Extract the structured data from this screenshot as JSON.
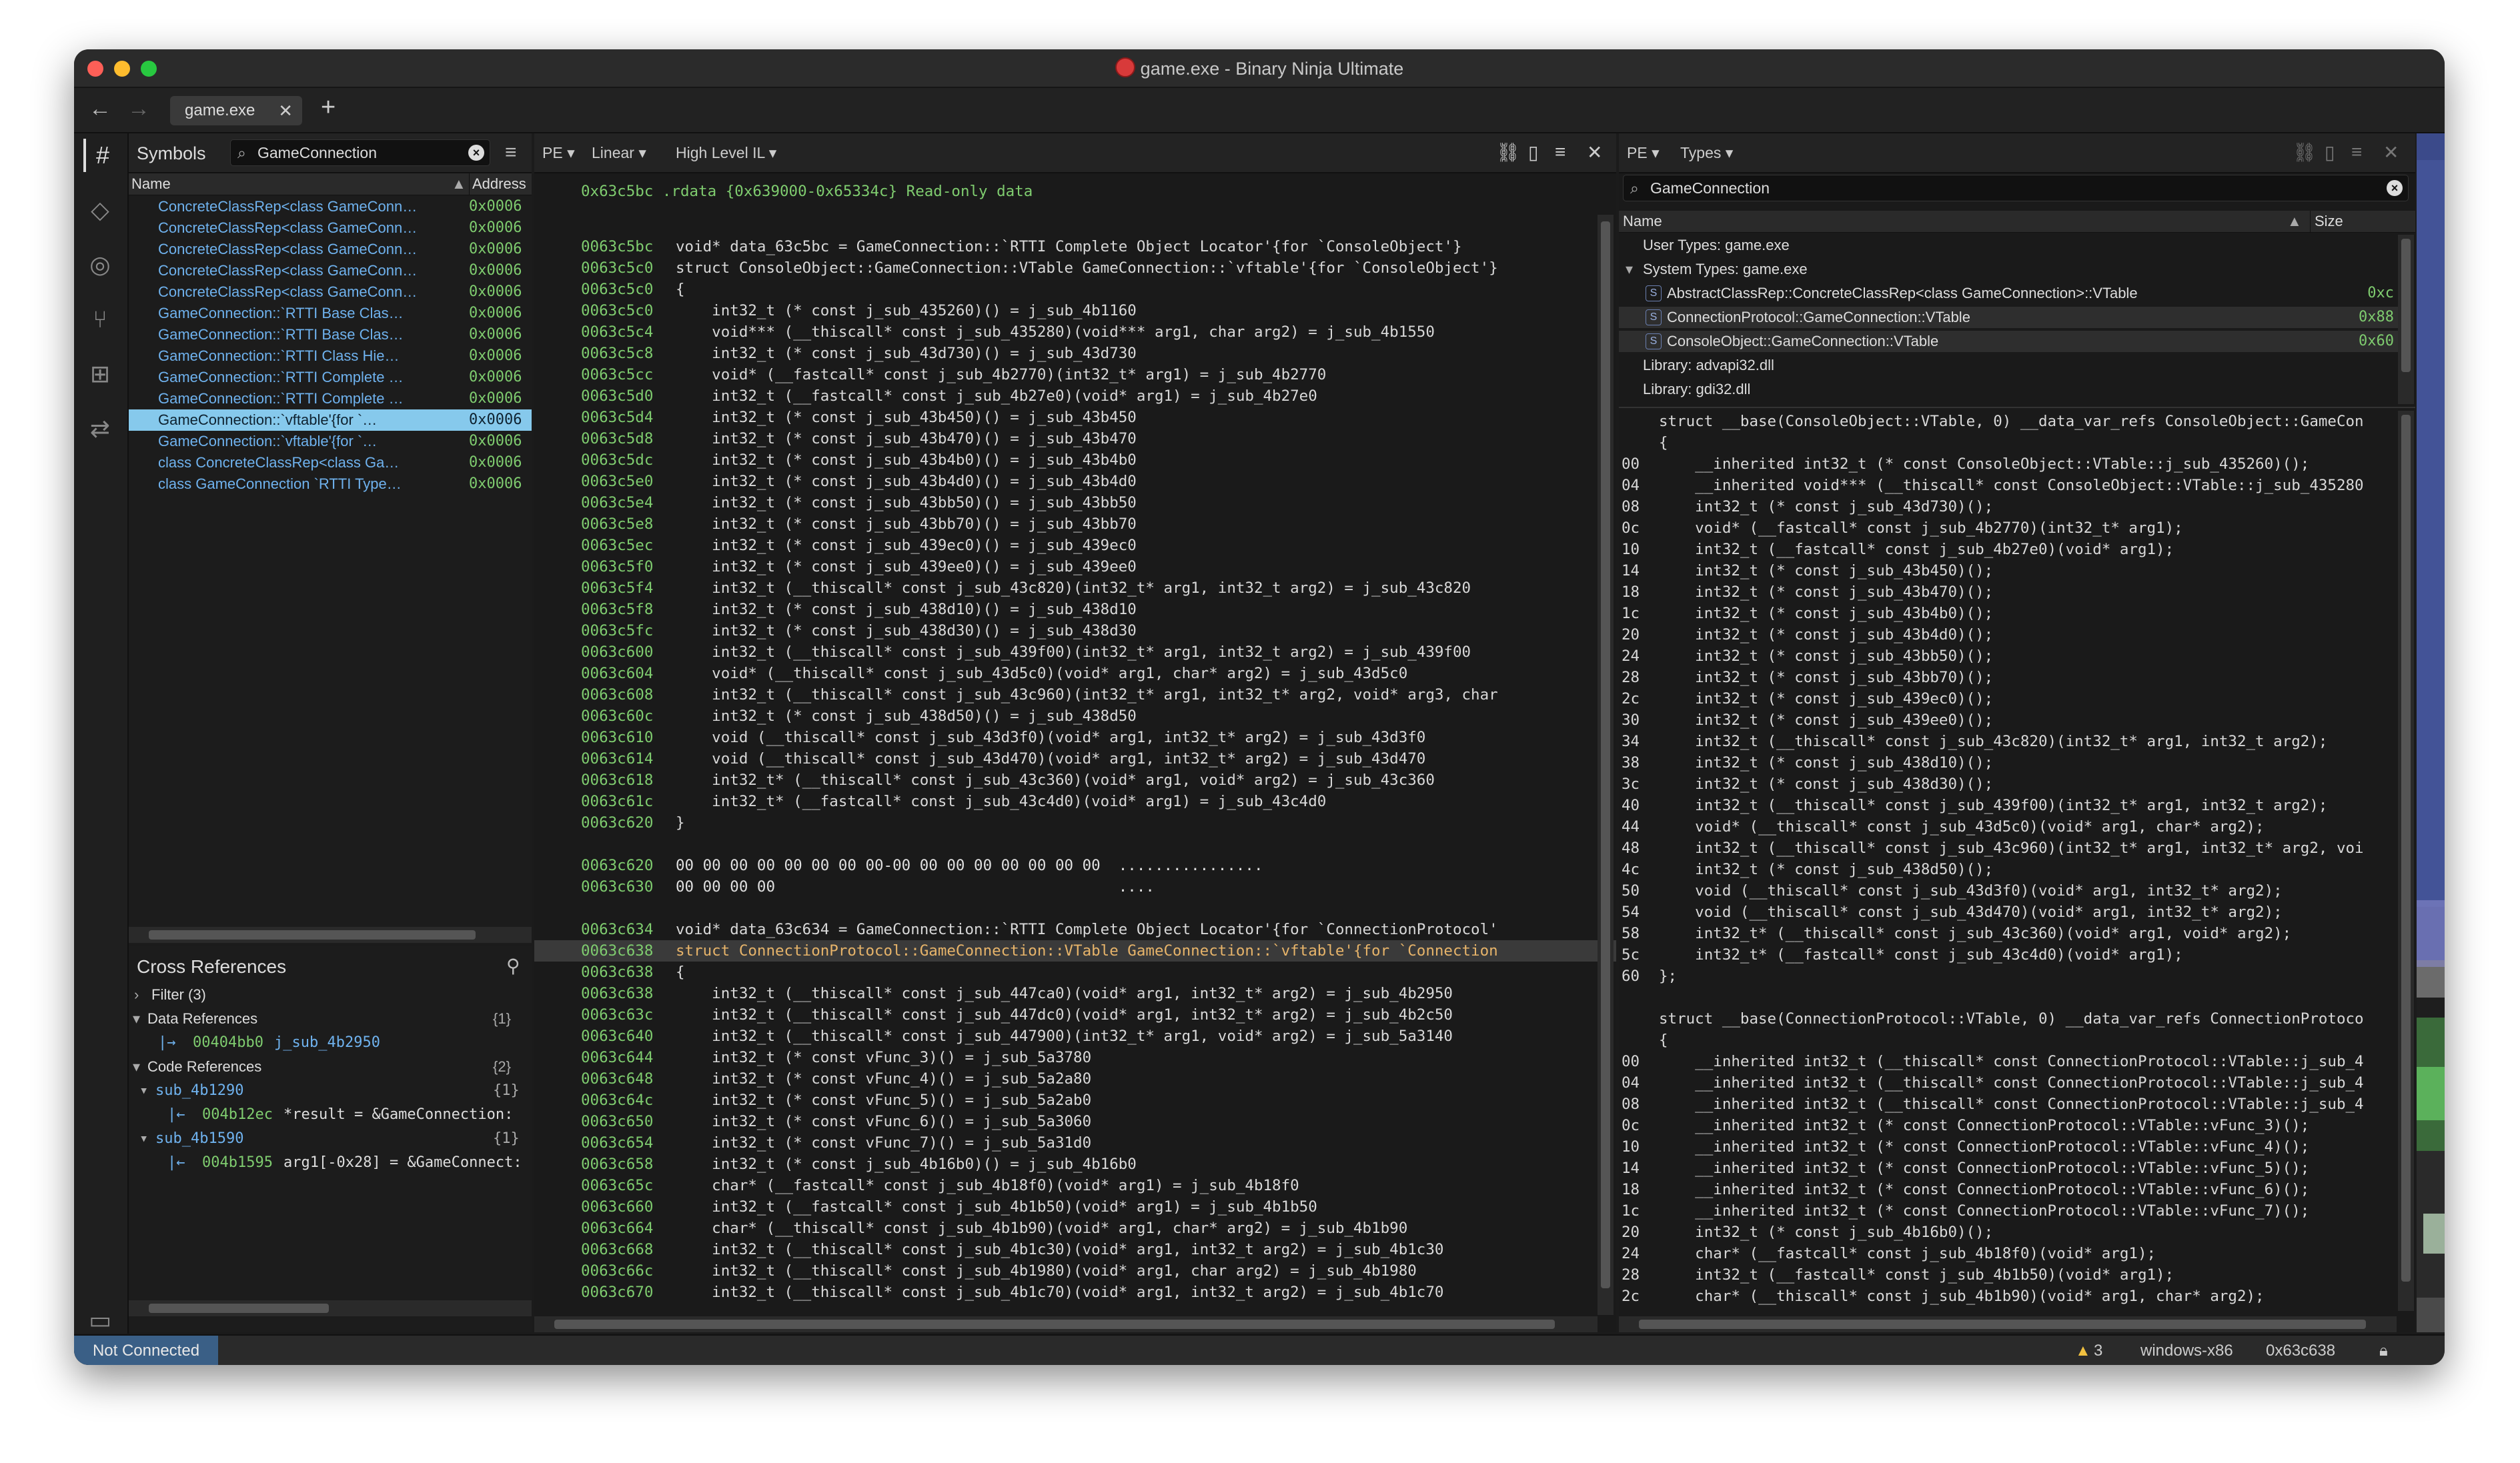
{
  "window": {
    "title": "game.exe - Binary Ninja Ultimate"
  },
  "tabs": [
    {
      "label": "game.exe"
    }
  ],
  "symbols": {
    "title": "Symbols",
    "search_value": "GameConnection",
    "col_name": "Name",
    "col_address": "Address",
    "rows": [
      {
        "name": "ConcreteClassRep<class GameConn…",
        "addr": "0x0006"
      },
      {
        "name": "ConcreteClassRep<class GameConn…",
        "addr": "0x0006"
      },
      {
        "name": "ConcreteClassRep<class GameConn…",
        "addr": "0x0006"
      },
      {
        "name": "ConcreteClassRep<class GameConn…",
        "addr": "0x0006"
      },
      {
        "name": "ConcreteClassRep<class GameConn…",
        "addr": "0x0006"
      },
      {
        "name": "GameConnection::`RTTI Base Clas…",
        "addr": "0x0006"
      },
      {
        "name": "GameConnection::`RTTI Base Clas…",
        "addr": "0x0006"
      },
      {
        "name": "GameConnection::`RTTI Class Hie…",
        "addr": "0x0006"
      },
      {
        "name": "GameConnection::`RTTI Complete …",
        "addr": "0x0006"
      },
      {
        "name": "GameConnection::`RTTI Complete …",
        "addr": "0x0006"
      },
      {
        "name": "GameConnection::`vftable'{for `…",
        "addr": "0x0006"
      },
      {
        "name": "GameConnection::`vftable'{for `…",
        "addr": "0x0006"
      },
      {
        "name": "class ConcreteClassRep<class Ga…",
        "addr": "0x0006"
      },
      {
        "name": "class GameConnection `RTTI Type…",
        "addr": "0x0006"
      }
    ]
  },
  "xrefs": {
    "title": "Cross References",
    "filter": "Filter (3)",
    "data_refs": {
      "label": "Data References",
      "count": "{1}",
      "items": [
        {
          "addr": "00404bb0",
          "text": "j_sub_4b2950"
        }
      ]
    },
    "code_refs": {
      "label": "Code References",
      "count": "{2}",
      "groups": [
        {
          "name": "sub_4b1290",
          "count": "{1}",
          "addr": "004b12ec",
          "text": "*result = &GameConnection:"
        },
        {
          "name": "sub_4b1590",
          "count": "{1}",
          "addr": "004b1595",
          "text": "arg1[-0x28] = &GameConnect:"
        }
      ]
    }
  },
  "center": {
    "view_type": "PE",
    "layout": "Linear",
    "il": "High Level IL",
    "header": "0x63c5bc .rdata {0x639000-0x65334c} Read-only data",
    "lines": [
      {
        "a": "",
        "t": ""
      },
      {
        "a": "0063c5bc",
        "t": "void* data_63c5bc = GameConnection::`RTTI Complete Object Locator'{for `ConsoleObject'}"
      },
      {
        "a": "0063c5c0",
        "t": "struct ConsoleObject::GameConnection::VTable GameConnection::`vftable'{for `ConsoleObject'}"
      },
      {
        "a": "0063c5c0",
        "t": "{"
      },
      {
        "a": "0063c5c0",
        "t": "    int32_t (* const j_sub_435260)() = j_sub_4b1160"
      },
      {
        "a": "0063c5c4",
        "t": "    void*** (__thiscall* const j_sub_435280)(void*** arg1, char arg2) = j_sub_4b1550"
      },
      {
        "a": "0063c5c8",
        "t": "    int32_t (* const j_sub_43d730)() = j_sub_43d730"
      },
      {
        "a": "0063c5cc",
        "t": "    void* (__fastcall* const j_sub_4b2770)(int32_t* arg1) = j_sub_4b2770"
      },
      {
        "a": "0063c5d0",
        "t": "    int32_t (__fastcall* const j_sub_4b27e0)(void* arg1) = j_sub_4b27e0"
      },
      {
        "a": "0063c5d4",
        "t": "    int32_t (* const j_sub_43b450)() = j_sub_43b450"
      },
      {
        "a": "0063c5d8",
        "t": "    int32_t (* const j_sub_43b470)() = j_sub_43b470"
      },
      {
        "a": "0063c5dc",
        "t": "    int32_t (* const j_sub_43b4b0)() = j_sub_43b4b0"
      },
      {
        "a": "0063c5e0",
        "t": "    int32_t (* const j_sub_43b4d0)() = j_sub_43b4d0"
      },
      {
        "a": "0063c5e4",
        "t": "    int32_t (* const j_sub_43bb50)() = j_sub_43bb50"
      },
      {
        "a": "0063c5e8",
        "t": "    int32_t (* const j_sub_43bb70)() = j_sub_43bb70"
      },
      {
        "a": "0063c5ec",
        "t": "    int32_t (* const j_sub_439ec0)() = j_sub_439ec0"
      },
      {
        "a": "0063c5f0",
        "t": "    int32_t (* const j_sub_439ee0)() = j_sub_439ee0"
      },
      {
        "a": "0063c5f4",
        "t": "    int32_t (__thiscall* const j_sub_43c820)(int32_t* arg1, int32_t arg2) = j_sub_43c820"
      },
      {
        "a": "0063c5f8",
        "t": "    int32_t (* const j_sub_438d10)() = j_sub_438d10"
      },
      {
        "a": "0063c5fc",
        "t": "    int32_t (* const j_sub_438d30)() = j_sub_438d30"
      },
      {
        "a": "0063c600",
        "t": "    int32_t (__thiscall* const j_sub_439f00)(int32_t* arg1, int32_t arg2) = j_sub_439f00"
      },
      {
        "a": "0063c604",
        "t": "    void* (__thiscall* const j_sub_43d5c0)(void* arg1, char* arg2) = j_sub_43d5c0"
      },
      {
        "a": "0063c608",
        "t": "    int32_t (__thiscall* const j_sub_43c960)(int32_t* arg1, int32_t* arg2, void* arg3, char"
      },
      {
        "a": "0063c60c",
        "t": "    int32_t (* const j_sub_438d50)() = j_sub_438d50"
      },
      {
        "a": "0063c610",
        "t": "    void (__thiscall* const j_sub_43d3f0)(void* arg1, int32_t* arg2) = j_sub_43d3f0"
      },
      {
        "a": "0063c614",
        "t": "    void (__thiscall* const j_sub_43d470)(void* arg1, int32_t* arg2) = j_sub_43d470"
      },
      {
        "a": "0063c618",
        "t": "    int32_t* (__thiscall* const j_sub_43c360)(void* arg1, void* arg2) = j_sub_43c360"
      },
      {
        "a": "0063c61c",
        "t": "    int32_t* (__fastcall* const j_sub_43c4d0)(void* arg1) = j_sub_43c4d0"
      },
      {
        "a": "0063c620",
        "t": "}"
      },
      {
        "a": "",
        "t": ""
      },
      {
        "a": "0063c620",
        "t": "00 00 00 00 00 00 00 00-00 00 00 00 00 00 00 00  ................"
      },
      {
        "a": "0063c630",
        "t": "00 00 00 00                                      ...."
      },
      {
        "a": "",
        "t": ""
      },
      {
        "a": "0063c634",
        "t": "void* data_63c634 = GameConnection::`RTTI Complete Object Locator'{for `ConnectionProtocol'"
      },
      {
        "a": "0063c638",
        "t": "struct ConnectionProtocol::GameConnection::VTable GameConnection::`vftable'{for `Connection",
        "hl": true
      },
      {
        "a": "0063c638",
        "t": "{"
      },
      {
        "a": "0063c638",
        "t": "    int32_t (__thiscall* const j_sub_447ca0)(void* arg1, int32_t* arg2) = j_sub_4b2950"
      },
      {
        "a": "0063c63c",
        "t": "    int32_t (__thiscall* const j_sub_447dc0)(void* arg1, int32_t* arg2) = j_sub_4b2c50"
      },
      {
        "a": "0063c640",
        "t": "    int32_t (__thiscall* const j_sub_447900)(int32_t* arg1, void* arg2) = j_sub_5a3140"
      },
      {
        "a": "0063c644",
        "t": "    int32_t (* const vFunc_3)() = j_sub_5a3780"
      },
      {
        "a": "0063c648",
        "t": "    int32_t (* const vFunc_4)() = j_sub_5a2a80"
      },
      {
        "a": "0063c64c",
        "t": "    int32_t (* const vFunc_5)() = j_sub_5a2ab0"
      },
      {
        "a": "0063c650",
        "t": "    int32_t (* const vFunc_6)() = j_sub_5a3060"
      },
      {
        "a": "0063c654",
        "t": "    int32_t (* const vFunc_7)() = j_sub_5a31d0"
      },
      {
        "a": "0063c658",
        "t": "    int32_t (* const j_sub_4b16b0)() = j_sub_4b16b0"
      },
      {
        "a": "0063c65c",
        "t": "    char* (__fastcall* const j_sub_4b18f0)(void* arg1) = j_sub_4b18f0"
      },
      {
        "a": "0063c660",
        "t": "    int32_t (__fastcall* const j_sub_4b1b50)(void* arg1) = j_sub_4b1b50"
      },
      {
        "a": "0063c664",
        "t": "    char* (__thiscall* const j_sub_4b1b90)(void* arg1, char* arg2) = j_sub_4b1b90"
      },
      {
        "a": "0063c668",
        "t": "    int32_t (__thiscall* const j_sub_4b1c30)(void* arg1, int32_t arg2) = j_sub_4b1c30"
      },
      {
        "a": "0063c66c",
        "t": "    int32_t (__thiscall* const j_sub_4b1980)(void* arg1, char arg2) = j_sub_4b1980"
      },
      {
        "a": "0063c670",
        "t": "    int32_t (__thiscall* const j_sub_4b1c70)(void* arg1, int32_t arg2) = j_sub_4b1c70"
      }
    ]
  },
  "types": {
    "view_type": "PE",
    "mode": "Types",
    "search_value": "GameConnection",
    "col_name": "Name",
    "col_size": "Size",
    "tree": [
      {
        "label": "User Types: game.exe",
        "size": "",
        "indent": 0
      },
      {
        "label": "System Types: game.exe",
        "size": "",
        "indent": 0,
        "caret": "▾"
      },
      {
        "label": "AbstractClassRep::ConcreteClassRep<class GameConnection>::VTable",
        "size": "0xc",
        "indent": 1,
        "s": true
      },
      {
        "label": "ConnectionProtocol::GameConnection::VTable",
        "size": "0x88",
        "indent": 1,
        "s": true,
        "sel": true
      },
      {
        "label": "ConsoleObject::GameConnection::VTable",
        "size": "0x60",
        "indent": 1,
        "s": true,
        "sel": true
      },
      {
        "label": "Library: advapi32.dll",
        "size": "",
        "indent": 0
      },
      {
        "label": "Library: gdi32.dll",
        "size": "",
        "indent": 0
      }
    ],
    "struct_lines": [
      {
        "o": "",
        "t": "struct __base(ConsoleObject::VTable, 0) __data_var_refs ConsoleObject::GameCon"
      },
      {
        "o": "",
        "t": "{"
      },
      {
        "o": "00",
        "t": "    __inherited int32_t (* const ConsoleObject::VTable::j_sub_435260)();"
      },
      {
        "o": "04",
        "t": "    __inherited void*** (__thiscall* const ConsoleObject::VTable::j_sub_435280"
      },
      {
        "o": "08",
        "t": "    int32_t (* const j_sub_43d730)();"
      },
      {
        "o": "0c",
        "t": "    void* (__fastcall* const j_sub_4b2770)(int32_t* arg1);"
      },
      {
        "o": "10",
        "t": "    int32_t (__fastcall* const j_sub_4b27e0)(void* arg1);"
      },
      {
        "o": "14",
        "t": "    int32_t (* const j_sub_43b450)();"
      },
      {
        "o": "18",
        "t": "    int32_t (* const j_sub_43b470)();"
      },
      {
        "o": "1c",
        "t": "    int32_t (* const j_sub_43b4b0)();"
      },
      {
        "o": "20",
        "t": "    int32_t (* const j_sub_43b4d0)();"
      },
      {
        "o": "24",
        "t": "    int32_t (* const j_sub_43bb50)();"
      },
      {
        "o": "28",
        "t": "    int32_t (* const j_sub_43bb70)();"
      },
      {
        "o": "2c",
        "t": "    int32_t (* const j_sub_439ec0)();"
      },
      {
        "o": "30",
        "t": "    int32_t (* const j_sub_439ee0)();"
      },
      {
        "o": "34",
        "t": "    int32_t (__thiscall* const j_sub_43c820)(int32_t* arg1, int32_t arg2);"
      },
      {
        "o": "38",
        "t": "    int32_t (* const j_sub_438d10)();"
      },
      {
        "o": "3c",
        "t": "    int32_t (* const j_sub_438d30)();"
      },
      {
        "o": "40",
        "t": "    int32_t (__thiscall* const j_sub_439f00)(int32_t* arg1, int32_t arg2);"
      },
      {
        "o": "44",
        "t": "    void* (__thiscall* const j_sub_43d5c0)(void* arg1, char* arg2);"
      },
      {
        "o": "48",
        "t": "    int32_t (__thiscall* const j_sub_43c960)(int32_t* arg1, int32_t* arg2, voi"
      },
      {
        "o": "4c",
        "t": "    int32_t (* const j_sub_438d50)();"
      },
      {
        "o": "50",
        "t": "    void (__thiscall* const j_sub_43d3f0)(void* arg1, int32_t* arg2);"
      },
      {
        "o": "54",
        "t": "    void (__thiscall* const j_sub_43d470)(void* arg1, int32_t* arg2);"
      },
      {
        "o": "58",
        "t": "    int32_t* (__thiscall* const j_sub_43c360)(void* arg1, void* arg2);"
      },
      {
        "o": "5c",
        "t": "    int32_t* (__fastcall* const j_sub_43c4d0)(void* arg1);"
      },
      {
        "o": "60",
        "t": "};"
      },
      {
        "o": "",
        "t": ""
      },
      {
        "o": "",
        "t": "struct __base(ConnectionProtocol::VTable, 0) __data_var_refs ConnectionProtoco"
      },
      {
        "o": "",
        "t": "{"
      },
      {
        "o": "00",
        "t": "    __inherited int32_t (__thiscall* const ConnectionProtocol::VTable::j_sub_4"
      },
      {
        "o": "04",
        "t": "    __inherited int32_t (__thiscall* const ConnectionProtocol::VTable::j_sub_4"
      },
      {
        "o": "08",
        "t": "    __inherited int32_t (__thiscall* const ConnectionProtocol::VTable::j_sub_4"
      },
      {
        "o": "0c",
        "t": "    __inherited int32_t (* const ConnectionProtocol::VTable::vFunc_3)();"
      },
      {
        "o": "10",
        "t": "    __inherited int32_t (* const ConnectionProtocol::VTable::vFunc_4)();"
      },
      {
        "o": "14",
        "t": "    __inherited int32_t (* const ConnectionProtocol::VTable::vFunc_5)();"
      },
      {
        "o": "18",
        "t": "    __inherited int32_t (* const ConnectionProtocol::VTable::vFunc_6)();"
      },
      {
        "o": "1c",
        "t": "    __inherited int32_t (* const ConnectionProtocol::VTable::vFunc_7)();"
      },
      {
        "o": "20",
        "t": "    int32_t (* const j_sub_4b16b0)();"
      },
      {
        "o": "24",
        "t": "    char* (__fastcall* const j_sub_4b18f0)(void* arg1);"
      },
      {
        "o": "28",
        "t": "    int32_t (__fastcall* const j_sub_4b1b50)(void* arg1);"
      },
      {
        "o": "2c",
        "t": "    char* (__thiscall* const j_sub_4b1b90)(void* arg1, char* arg2);"
      }
    ]
  },
  "status": {
    "connection": "Not Connected",
    "warnings": "3",
    "platform": "windows-x86",
    "address": "0x63c638"
  },
  "colors": {
    "accent": "#86c9ec",
    "address": "#7fcc6f",
    "symbol": "#6fb2ee",
    "highlight_text": "#e7b46a",
    "status_connect": "#3a5f86"
  }
}
